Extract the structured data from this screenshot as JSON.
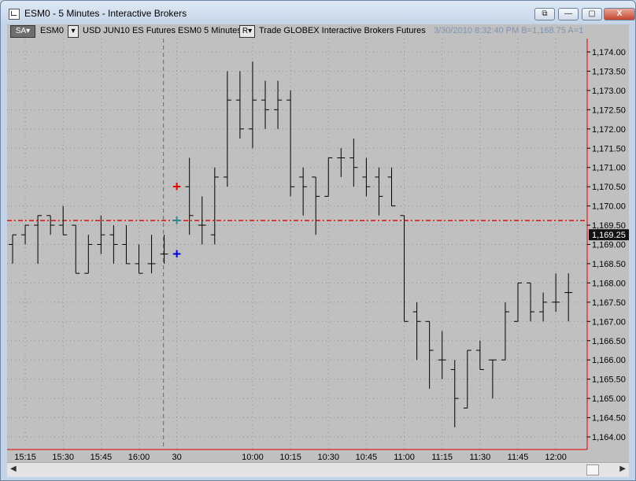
{
  "window": {
    "title": "ESM0 - 5 Minutes - Interactive Brokers",
    "buttons": [
      "⧉",
      "—",
      "▢",
      "X"
    ]
  },
  "toolbar": {
    "sa": "SA",
    "symbol": "ESM0",
    "desc": "USD JUN10 ES Futures ESM0  5 Minutes",
    "r": "R",
    "trade": "Trade  GLOBEX  Interactive Brokers  Futures",
    "status": "3/30/2010  8:32:40 PM  B=1,168.75  A=1"
  },
  "colors": {
    "chart_bg": "#c0c0c0",
    "bars": "#000000",
    "price_line": "#e00000",
    "marker_red": "#e00000",
    "marker_teal": "#2e8b8b",
    "marker_blue": "#0000e0"
  },
  "chart_data": {
    "type": "bar",
    "subtype": "ohlc",
    "ylim": [
      1163.75,
      1174.5
    ],
    "y_ticks": [
      1164.0,
      1164.5,
      1165.0,
      1165.5,
      1166.0,
      1166.5,
      1167.0,
      1167.5,
      1168.0,
      1168.5,
      1169.0,
      1169.5,
      1170.0,
      1170.5,
      1171.0,
      1171.5,
      1172.0,
      1172.5,
      1173.0,
      1173.5,
      1174.0
    ],
    "y_tick_labels": [
      "1,164.00",
      "1,164.50",
      "1,165.00",
      "1,165.50",
      "1,166.00",
      "1,166.50",
      "1,167.00",
      "1,167.50",
      "1,168.00",
      "1,168.50",
      "1,169.00",
      "1,169.50",
      "1,170.00",
      "1,170.50",
      "1,171.00",
      "1,171.50",
      "1,172.00",
      "1,172.50",
      "1,173.00",
      "1,173.50",
      "1,174.00"
    ],
    "current_price": 1169.62,
    "current_price_label": "1,169.25",
    "x_labels": [
      {
        "i": 1,
        "text": "15:15"
      },
      {
        "i": 4,
        "text": "15:30"
      },
      {
        "i": 7,
        "text": "15:45"
      },
      {
        "i": 10,
        "text": "16:00"
      },
      {
        "i": 13,
        "text": "30"
      },
      {
        "i": 19,
        "text": "10:00"
      },
      {
        "i": 22,
        "text": "10:15"
      },
      {
        "i": 25,
        "text": "10:30"
      },
      {
        "i": 28,
        "text": "10:45"
      },
      {
        "i": 31,
        "text": "11:00"
      },
      {
        "i": 34,
        "text": "11:15"
      },
      {
        "i": 37,
        "text": "11:30"
      },
      {
        "i": 40,
        "text": "11:45"
      },
      {
        "i": 43,
        "text": "12:00"
      }
    ],
    "session_break_index": 13,
    "bars": [
      [
        1169.0,
        1169.25,
        1168.5,
        1169.25
      ],
      [
        1169.25,
        1169.5,
        1169.0,
        1169.5
      ],
      [
        1169.5,
        1169.75,
        1168.5,
        1169.75
      ],
      [
        1169.75,
        1169.75,
        1169.25,
        1169.5
      ],
      [
        1169.5,
        1170.0,
        1169.25,
        1169.25
      ],
      [
        1169.5,
        1169.5,
        1168.25,
        1168.25
      ],
      [
        1168.25,
        1169.25,
        1168.25,
        1169.0
      ],
      [
        1169.0,
        1169.75,
        1168.75,
        1169.25
      ],
      [
        1169.25,
        1169.5,
        1168.5,
        1169.0
      ],
      [
        1169.0,
        1169.5,
        1168.5,
        1168.5
      ],
      [
        1168.5,
        1169.0,
        1168.25,
        1168.25
      ],
      [
        1168.5,
        1169.25,
        1168.25,
        1168.5
      ],
      [
        1168.75,
        1169.25,
        1168.5,
        1168.75
      ],
      [
        1168.75,
        1168.75,
        1168.75,
        1168.75
      ],
      [
        1170.5,
        1171.25,
        1169.25,
        1169.75
      ],
      [
        1169.5,
        1170.25,
        1169.0,
        1169.5
      ],
      [
        1169.25,
        1171.0,
        1169.0,
        1170.75
      ],
      [
        1170.75,
        1173.5,
        1170.5,
        1172.75
      ],
      [
        1172.75,
        1173.5,
        1171.75,
        1172.0
      ],
      [
        1172.0,
        1173.75,
        1171.5,
        1172.75
      ],
      [
        1172.75,
        1173.25,
        1172.0,
        1172.5
      ],
      [
        1172.5,
        1173.25,
        1172.0,
        1172.75
      ],
      [
        1172.75,
        1173.0,
        1170.25,
        1170.5
      ],
      [
        1170.75,
        1171.0,
        1169.75,
        1170.5
      ],
      [
        1170.75,
        1170.75,
        1169.25,
        1170.25
      ],
      [
        1170.25,
        1171.25,
        1170.25,
        1171.25
      ],
      [
        1171.25,
        1171.5,
        1170.75,
        1171.25
      ],
      [
        1171.25,
        1171.75,
        1170.5,
        1171.0
      ],
      [
        1170.75,
        1171.25,
        1170.25,
        1170.5
      ],
      [
        1170.75,
        1171.0,
        1169.75,
        1170.25
      ],
      [
        1170.75,
        1171.0,
        1170.0,
        1170.0
      ],
      [
        1169.75,
        1169.75,
        1167.0,
        1167.0
      ],
      [
        1167.25,
        1167.5,
        1166.0,
        1167.0
      ],
      [
        1167.0,
        1167.0,
        1165.25,
        1166.25
      ],
      [
        1166.0,
        1166.75,
        1165.5,
        1166.0
      ],
      [
        1165.75,
        1166.0,
        1164.25,
        1165.0
      ],
      [
        1164.75,
        1166.25,
        1164.75,
        1166.25
      ],
      [
        1166.25,
        1166.5,
        1165.75,
        1165.75
      ],
      [
        1166.0,
        1166.0,
        1165.0,
        1166.0
      ],
      [
        1166.0,
        1167.5,
        1166.0,
        1167.25
      ],
      [
        1167.0,
        1168.0,
        1167.0,
        1168.0
      ],
      [
        1168.0,
        1168.0,
        1167.0,
        1167.25
      ],
      [
        1167.25,
        1167.75,
        1167.0,
        1167.5
      ],
      [
        1167.5,
        1168.25,
        1167.25,
        1167.5
      ],
      [
        1167.75,
        1168.25,
        1167.0,
        1167.75
      ]
    ],
    "markers": [
      {
        "i": 13,
        "y": 1170.5,
        "color": "#e00000",
        "label": "+"
      },
      {
        "i": 13,
        "y": 1169.625,
        "color": "#2e8b8b",
        "label": "+"
      },
      {
        "i": 13,
        "y": 1168.75,
        "color": "#0000e0",
        "label": "+"
      }
    ]
  }
}
